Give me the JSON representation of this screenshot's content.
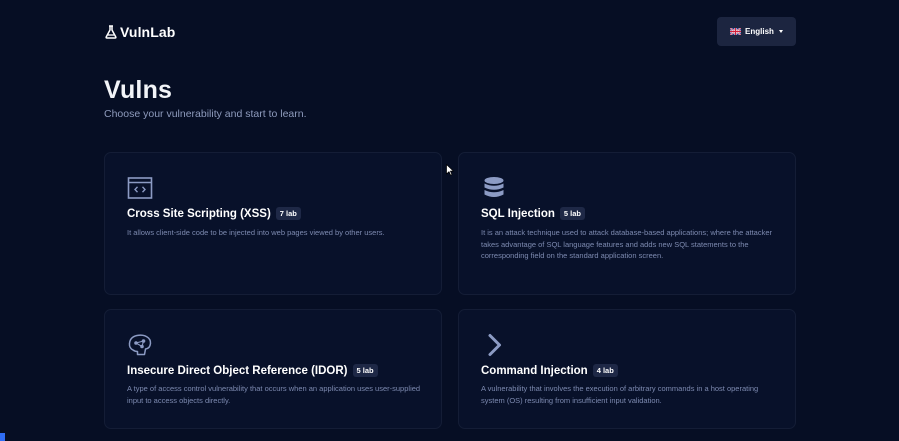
{
  "brand": {
    "name": "VulnLab",
    "logo_icon": "flask-icon"
  },
  "language": {
    "flag_icon": "uk-flag-icon",
    "label": "English"
  },
  "page": {
    "title": "Vulns",
    "subtitle": "Choose your vulnerability and start to learn."
  },
  "labs": [
    {
      "icon": "code-window-icon",
      "title": "Cross Site Scripting (XSS)",
      "badge": "7 lab",
      "description": "It allows client-side code to be injected into web pages viewed by other users."
    },
    {
      "icon": "database-icon",
      "title": "SQL Injection",
      "badge": "5 lab",
      "description": "It is an attack technique used to attack database-based applications; where the attacker takes advantage of SQL language features and adds new SQL statements to the corresponding field on the standard application screen."
    },
    {
      "icon": "network-brain-icon",
      "title": "Insecure Direct Object Reference (IDOR)",
      "badge": "5 lab",
      "description": "A type of access control vulnerability that occurs when an application uses user-supplied input to access objects directly."
    },
    {
      "icon": "chevron-right-icon",
      "title": "Command Injection",
      "badge": "4 lab",
      "description": "A vulnerability that involves the execution of arbitrary commands in a host operating system (OS) resulting from insufficient input validation."
    }
  ],
  "colors": {
    "background": "#060e24",
    "card": "#08112a",
    "badge": "#1e2846",
    "subtitle": "#8e9bbd",
    "icon": "#8c9bc4"
  }
}
